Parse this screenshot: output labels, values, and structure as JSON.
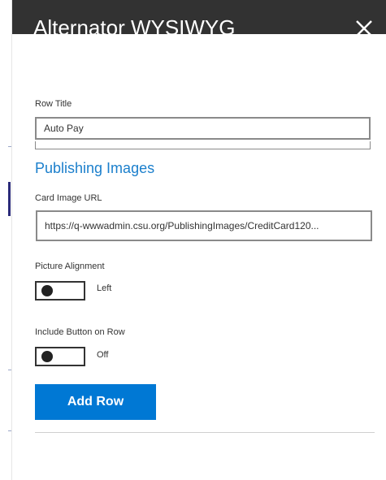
{
  "panel": {
    "title": "Alternator WYSIWYG",
    "close_icon": "close-icon"
  },
  "form": {
    "row_title_label": "Row Title",
    "row_title_value": "Auto Pay",
    "publishing_images_heading": "Publishing Images",
    "card_image_url_label": "Card Image URL",
    "card_image_url_value": "https://q-wwwadmin.csu.org/PublishingImages/CreditCard120...",
    "picture_alignment_label": "Picture Alignment",
    "picture_alignment_value": "Left",
    "include_button_label": "Include Button on Row",
    "include_button_value": "Off",
    "add_row_label": "Add Row"
  },
  "colors": {
    "header_bg": "#323232",
    "accent": "#0078d4",
    "heading_blue": "#1b7fcc"
  }
}
